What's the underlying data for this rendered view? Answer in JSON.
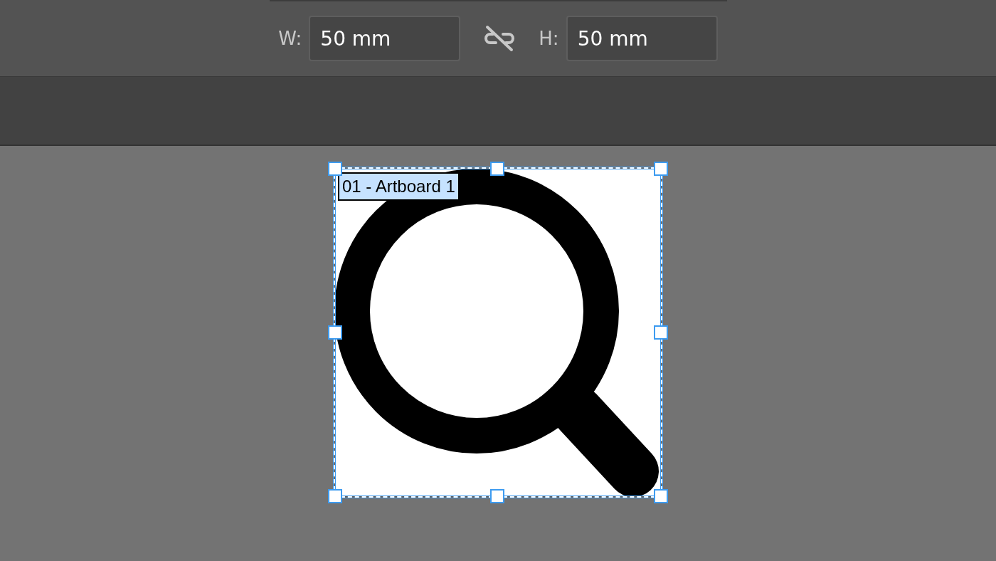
{
  "toolbar": {
    "fields": [
      {
        "label": "W:",
        "value": "50 mm"
      },
      {
        "label": "H:",
        "value": "50 mm"
      }
    ]
  },
  "artboard": {
    "name": "01 - Artboard 1"
  }
}
